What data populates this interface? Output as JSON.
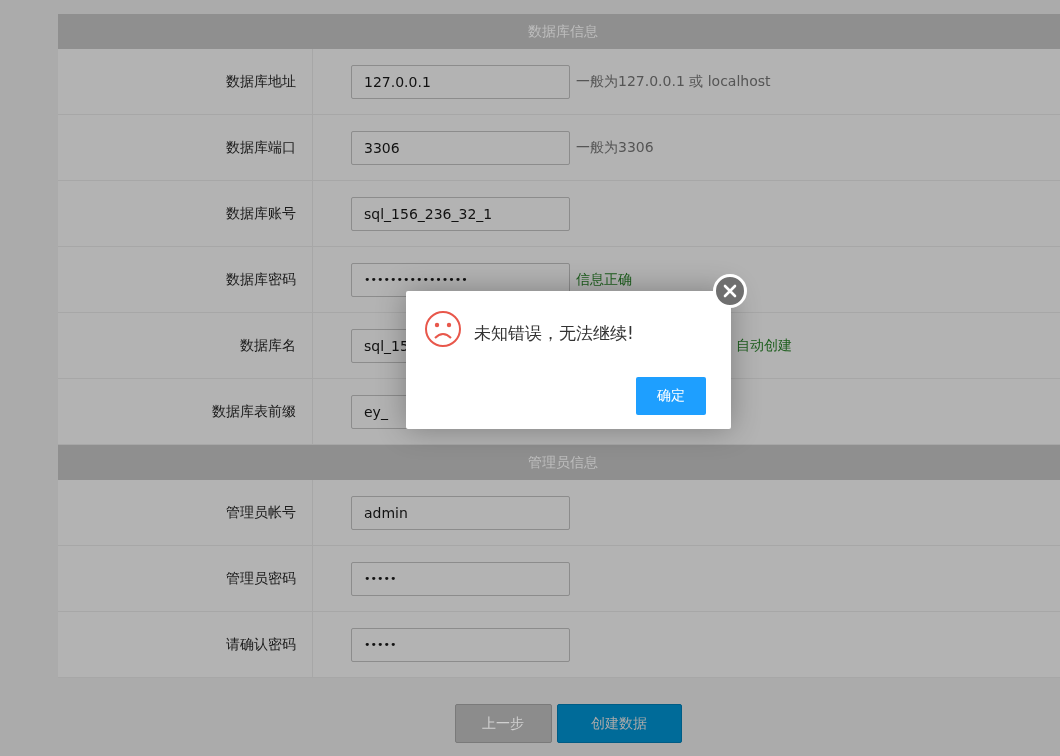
{
  "sections": [
    {
      "title": "数据库信息",
      "rows": [
        {
          "label": "数据库地址",
          "value": "127.0.0.1",
          "kind": "text",
          "hint": "一般为127.0.0.1 或 localhost",
          "color": "#555555"
        },
        {
          "label": "数据库端口",
          "value": "3306",
          "kind": "text",
          "hint": "一般为3306",
          "color": "#555555"
        },
        {
          "label": "数据库账号",
          "value": "sql_156_236_32_1",
          "kind": "text"
        },
        {
          "label": "数据库密码",
          "value": "••••••••••••••••",
          "kind": "password",
          "hint": "信息正确",
          "color": "#1d5e1d"
        },
        {
          "label": "数据库名",
          "value": "sql_15",
          "kind": "text",
          "hint": "自动创建",
          "color": "#1d5e1d",
          "hint_offset": true
        },
        {
          "label": "数据库表前缀",
          "value": "ey_",
          "kind": "text"
        }
      ]
    },
    {
      "title": "管理员信息",
      "rows": [
        {
          "label": "管理员帐号",
          "value": "admin",
          "kind": "text"
        },
        {
          "label": "管理员密码",
          "value": "•••••",
          "kind": "password"
        },
        {
          "label": "请确认密码",
          "value": "•••••",
          "kind": "password"
        }
      ]
    }
  ],
  "buttons": [
    {
      "label": "上一步",
      "kind": "secondary"
    },
    {
      "label": "创建数据",
      "kind": "primary"
    }
  ],
  "dialog": {
    "message": "未知错误，无法继续!",
    "confirm": "确定"
  }
}
